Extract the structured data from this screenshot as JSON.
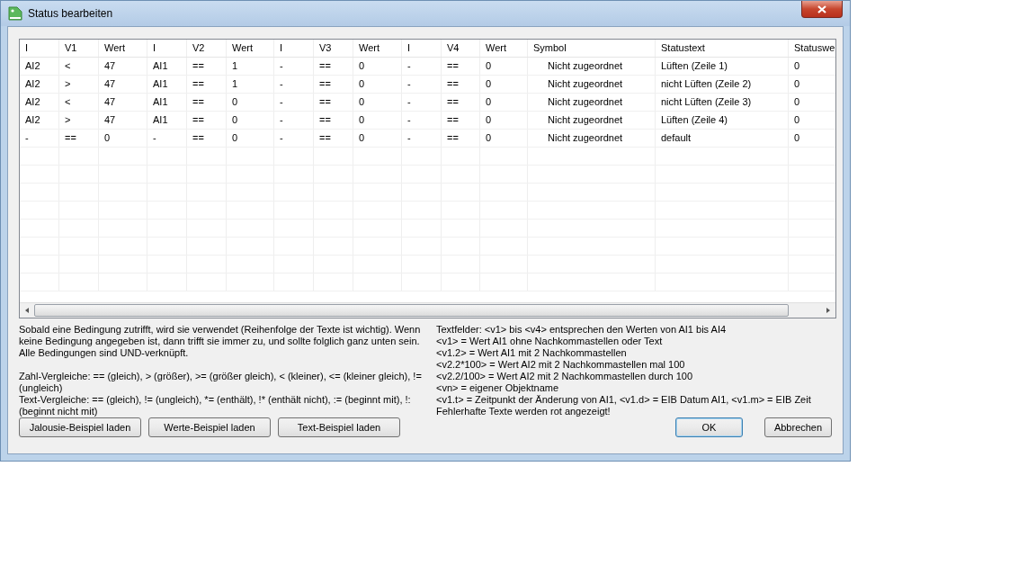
{
  "window": {
    "title": "Status bearbeiten"
  },
  "table": {
    "columns": [
      "I",
      "V1",
      "Wert",
      "I",
      "V2",
      "Wert",
      "I",
      "V3",
      "Wert",
      "I",
      "V4",
      "Wert",
      "Symbol",
      "Statustext",
      "Statuswe"
    ],
    "rows": [
      [
        "AI2",
        "<",
        "47",
        "AI1",
        "==",
        "1",
        "-",
        "==",
        "0",
        "-",
        "==",
        "0",
        "Nicht zugeordnet",
        "Lüften (Zeile 1)",
        "0"
      ],
      [
        "AI2",
        ">",
        "47",
        "AI1",
        "==",
        "1",
        "-",
        "==",
        "0",
        "-",
        "==",
        "0",
        "Nicht zugeordnet",
        "nicht Lüften (Zeile 2)",
        "0"
      ],
      [
        "AI2",
        "<",
        "47",
        "AI1",
        "==",
        "0",
        "-",
        "==",
        "0",
        "-",
        "==",
        "0",
        "Nicht zugeordnet",
        "nicht Lüften (Zeile 3)",
        "0"
      ],
      [
        "AI2",
        ">",
        "47",
        "AI1",
        "==",
        "0",
        "-",
        "==",
        "0",
        "-",
        "==",
        "0",
        "Nicht zugeordnet",
        "Lüften (Zeile 4)",
        "0"
      ],
      [
        "-",
        "==",
        "0",
        "-",
        "==",
        "0",
        "-",
        "==",
        "0",
        "-",
        "==",
        "0",
        "Nicht zugeordnet",
        "default",
        "0"
      ]
    ]
  },
  "help_left": [
    "Sobald eine Bedingung zutrifft, wird sie verwendet (Reihenfolge der Texte ist wichtig). Wenn keine Bedingung angegeben ist, dann trifft sie immer zu, und sollte folglich ganz unten sein. Alle Bedingungen sind UND-verknüpft.",
    "Zahl-Vergleiche: == (gleich), > (größer), >= (größer gleich), < (kleiner), <= (kleiner gleich), != (ungleich)",
    "Text-Vergleiche: == (gleich), != (ungleich), *= (enthält), !* (enthält nicht), := (beginnt mit), !: (beginnt nicht mit)"
  ],
  "help_right": [
    "Textfelder: <v1> bis <v4> entsprechen den Werten von AI1 bis AI4",
    "<v1> = Wert AI1 ohne Nachkommastellen oder Text",
    "<v1.2> = Wert AI1 mit 2 Nachkommastellen",
    "<v2.2*100> = Wert AI2 mit 2 Nachkommastellen mal 100",
    "<v2.2/100> = Wert AI2 mit 2 Nachkommastellen durch 100",
    "<vn> = eigener Objektname",
    "<v1.t> = Zeitpunkt der Änderung von AI1, <v1.d> = EIB Datum AI1, <v1.m> = EIB Zeit",
    "Fehlerhafte Texte werden rot angezeigt!"
  ],
  "example_buttons": [
    "Jalousie-Beispiel laden",
    "Werte-Beispiel laden",
    "Text-Beispiel laden"
  ],
  "dialog_buttons": [
    {
      "label": "OK",
      "focused": true
    },
    {
      "label": "Abbrechen",
      "focused": false
    }
  ]
}
